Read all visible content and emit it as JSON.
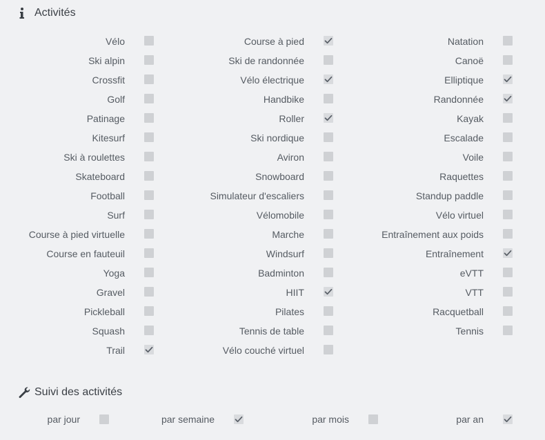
{
  "sections": {
    "activities_title": "Activités",
    "tracking_title": "Suivi des activités"
  },
  "activities": [
    [
      {
        "label": "Vélo",
        "checked": false
      },
      {
        "label": "Course à pied",
        "checked": true
      },
      {
        "label": "Natation",
        "checked": false
      }
    ],
    [
      {
        "label": "Ski alpin",
        "checked": false
      },
      {
        "label": "Ski de randonnée",
        "checked": false
      },
      {
        "label": "Canoë",
        "checked": false
      }
    ],
    [
      {
        "label": "Crossfit",
        "checked": false
      },
      {
        "label": "Vélo électrique",
        "checked": true
      },
      {
        "label": "Elliptique",
        "checked": true
      }
    ],
    [
      {
        "label": "Golf",
        "checked": false
      },
      {
        "label": "Handbike",
        "checked": false
      },
      {
        "label": "Randonnée",
        "checked": true
      }
    ],
    [
      {
        "label": "Patinage",
        "checked": false
      },
      {
        "label": "Roller",
        "checked": true
      },
      {
        "label": "Kayak",
        "checked": false
      }
    ],
    [
      {
        "label": "Kitesurf",
        "checked": false
      },
      {
        "label": "Ski nordique",
        "checked": false
      },
      {
        "label": "Escalade",
        "checked": false
      }
    ],
    [
      {
        "label": "Ski à roulettes",
        "checked": false
      },
      {
        "label": "Aviron",
        "checked": false
      },
      {
        "label": "Voile",
        "checked": false
      }
    ],
    [
      {
        "label": "Skateboard",
        "checked": false
      },
      {
        "label": "Snowboard",
        "checked": false
      },
      {
        "label": "Raquettes",
        "checked": false
      }
    ],
    [
      {
        "label": "Football",
        "checked": false
      },
      {
        "label": "Simulateur d'escaliers",
        "checked": false
      },
      {
        "label": "Standup paddle",
        "checked": false
      }
    ],
    [
      {
        "label": "Surf",
        "checked": false
      },
      {
        "label": "Vélomobile",
        "checked": false
      },
      {
        "label": "Vélo virtuel",
        "checked": false
      }
    ],
    [
      {
        "label": "Course à pied virtuelle",
        "checked": false
      },
      {
        "label": "Marche",
        "checked": false
      },
      {
        "label": "Entraînement aux poids",
        "checked": false
      }
    ],
    [
      {
        "label": "Course en fauteuil",
        "checked": false
      },
      {
        "label": "Windsurf",
        "checked": false
      },
      {
        "label": "Entraînement",
        "checked": true
      }
    ],
    [
      {
        "label": "Yoga",
        "checked": false
      },
      {
        "label": "Badminton",
        "checked": false
      },
      {
        "label": "eVTT",
        "checked": false
      }
    ],
    [
      {
        "label": "Gravel",
        "checked": false
      },
      {
        "label": "HIIT",
        "checked": true
      },
      {
        "label": "VTT",
        "checked": false
      }
    ],
    [
      {
        "label": "Pickleball",
        "checked": false
      },
      {
        "label": "Pilates",
        "checked": false
      },
      {
        "label": "Racquetball",
        "checked": false
      }
    ],
    [
      {
        "label": "Squash",
        "checked": false
      },
      {
        "label": "Tennis de table",
        "checked": false
      },
      {
        "label": "Tennis",
        "checked": false
      }
    ],
    [
      {
        "label": "Trail",
        "checked": true
      },
      {
        "label": "Vélo couché virtuel",
        "checked": false
      },
      null
    ]
  ],
  "tracking": [
    {
      "label": "par jour",
      "checked": false
    },
    {
      "label": "par semaine",
      "checked": true
    },
    {
      "label": "par mois",
      "checked": false
    },
    {
      "label": "par an",
      "checked": true
    }
  ],
  "colors": {
    "background": "#f0f1f3",
    "checkbox": "#cfd1d4",
    "check_mark": "#5a6068",
    "text": "#555b62"
  }
}
